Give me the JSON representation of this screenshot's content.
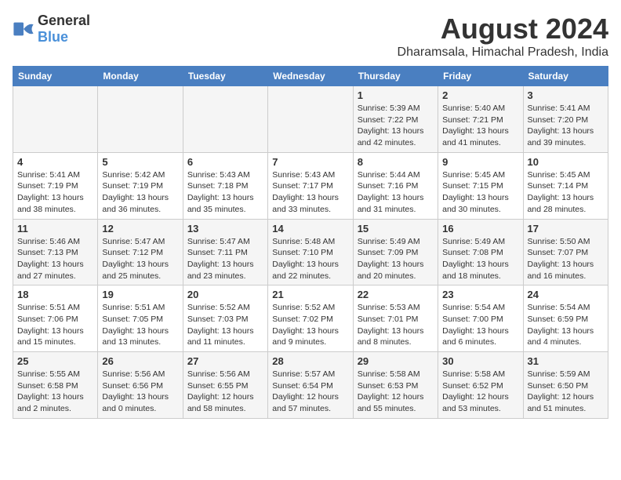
{
  "logo": {
    "general": "General",
    "blue": "Blue"
  },
  "title": "August 2024",
  "subtitle": "Dharamsala, Himachal Pradesh, India",
  "weekdays": [
    "Sunday",
    "Monday",
    "Tuesday",
    "Wednesday",
    "Thursday",
    "Friday",
    "Saturday"
  ],
  "weeks": [
    [
      {
        "day": "",
        "info": ""
      },
      {
        "day": "",
        "info": ""
      },
      {
        "day": "",
        "info": ""
      },
      {
        "day": "",
        "info": ""
      },
      {
        "day": "1",
        "info": "Sunrise: 5:39 AM\nSunset: 7:22 PM\nDaylight: 13 hours\nand 42 minutes."
      },
      {
        "day": "2",
        "info": "Sunrise: 5:40 AM\nSunset: 7:21 PM\nDaylight: 13 hours\nand 41 minutes."
      },
      {
        "day": "3",
        "info": "Sunrise: 5:41 AM\nSunset: 7:20 PM\nDaylight: 13 hours\nand 39 minutes."
      }
    ],
    [
      {
        "day": "4",
        "info": "Sunrise: 5:41 AM\nSunset: 7:19 PM\nDaylight: 13 hours\nand 38 minutes."
      },
      {
        "day": "5",
        "info": "Sunrise: 5:42 AM\nSunset: 7:19 PM\nDaylight: 13 hours\nand 36 minutes."
      },
      {
        "day": "6",
        "info": "Sunrise: 5:43 AM\nSunset: 7:18 PM\nDaylight: 13 hours\nand 35 minutes."
      },
      {
        "day": "7",
        "info": "Sunrise: 5:43 AM\nSunset: 7:17 PM\nDaylight: 13 hours\nand 33 minutes."
      },
      {
        "day": "8",
        "info": "Sunrise: 5:44 AM\nSunset: 7:16 PM\nDaylight: 13 hours\nand 31 minutes."
      },
      {
        "day": "9",
        "info": "Sunrise: 5:45 AM\nSunset: 7:15 PM\nDaylight: 13 hours\nand 30 minutes."
      },
      {
        "day": "10",
        "info": "Sunrise: 5:45 AM\nSunset: 7:14 PM\nDaylight: 13 hours\nand 28 minutes."
      }
    ],
    [
      {
        "day": "11",
        "info": "Sunrise: 5:46 AM\nSunset: 7:13 PM\nDaylight: 13 hours\nand 27 minutes."
      },
      {
        "day": "12",
        "info": "Sunrise: 5:47 AM\nSunset: 7:12 PM\nDaylight: 13 hours\nand 25 minutes."
      },
      {
        "day": "13",
        "info": "Sunrise: 5:47 AM\nSunset: 7:11 PM\nDaylight: 13 hours\nand 23 minutes."
      },
      {
        "day": "14",
        "info": "Sunrise: 5:48 AM\nSunset: 7:10 PM\nDaylight: 13 hours\nand 22 minutes."
      },
      {
        "day": "15",
        "info": "Sunrise: 5:49 AM\nSunset: 7:09 PM\nDaylight: 13 hours\nand 20 minutes."
      },
      {
        "day": "16",
        "info": "Sunrise: 5:49 AM\nSunset: 7:08 PM\nDaylight: 13 hours\nand 18 minutes."
      },
      {
        "day": "17",
        "info": "Sunrise: 5:50 AM\nSunset: 7:07 PM\nDaylight: 13 hours\nand 16 minutes."
      }
    ],
    [
      {
        "day": "18",
        "info": "Sunrise: 5:51 AM\nSunset: 7:06 PM\nDaylight: 13 hours\nand 15 minutes."
      },
      {
        "day": "19",
        "info": "Sunrise: 5:51 AM\nSunset: 7:05 PM\nDaylight: 13 hours\nand 13 minutes."
      },
      {
        "day": "20",
        "info": "Sunrise: 5:52 AM\nSunset: 7:03 PM\nDaylight: 13 hours\nand 11 minutes."
      },
      {
        "day": "21",
        "info": "Sunrise: 5:52 AM\nSunset: 7:02 PM\nDaylight: 13 hours\nand 9 minutes."
      },
      {
        "day": "22",
        "info": "Sunrise: 5:53 AM\nSunset: 7:01 PM\nDaylight: 13 hours\nand 8 minutes."
      },
      {
        "day": "23",
        "info": "Sunrise: 5:54 AM\nSunset: 7:00 PM\nDaylight: 13 hours\nand 6 minutes."
      },
      {
        "day": "24",
        "info": "Sunrise: 5:54 AM\nSunset: 6:59 PM\nDaylight: 13 hours\nand 4 minutes."
      }
    ],
    [
      {
        "day": "25",
        "info": "Sunrise: 5:55 AM\nSunset: 6:58 PM\nDaylight: 13 hours\nand 2 minutes."
      },
      {
        "day": "26",
        "info": "Sunrise: 5:56 AM\nSunset: 6:56 PM\nDaylight: 13 hours\nand 0 minutes."
      },
      {
        "day": "27",
        "info": "Sunrise: 5:56 AM\nSunset: 6:55 PM\nDaylight: 12 hours\nand 58 minutes."
      },
      {
        "day": "28",
        "info": "Sunrise: 5:57 AM\nSunset: 6:54 PM\nDaylight: 12 hours\nand 57 minutes."
      },
      {
        "day": "29",
        "info": "Sunrise: 5:58 AM\nSunset: 6:53 PM\nDaylight: 12 hours\nand 55 minutes."
      },
      {
        "day": "30",
        "info": "Sunrise: 5:58 AM\nSunset: 6:52 PM\nDaylight: 12 hours\nand 53 minutes."
      },
      {
        "day": "31",
        "info": "Sunrise: 5:59 AM\nSunset: 6:50 PM\nDaylight: 12 hours\nand 51 minutes."
      }
    ]
  ]
}
